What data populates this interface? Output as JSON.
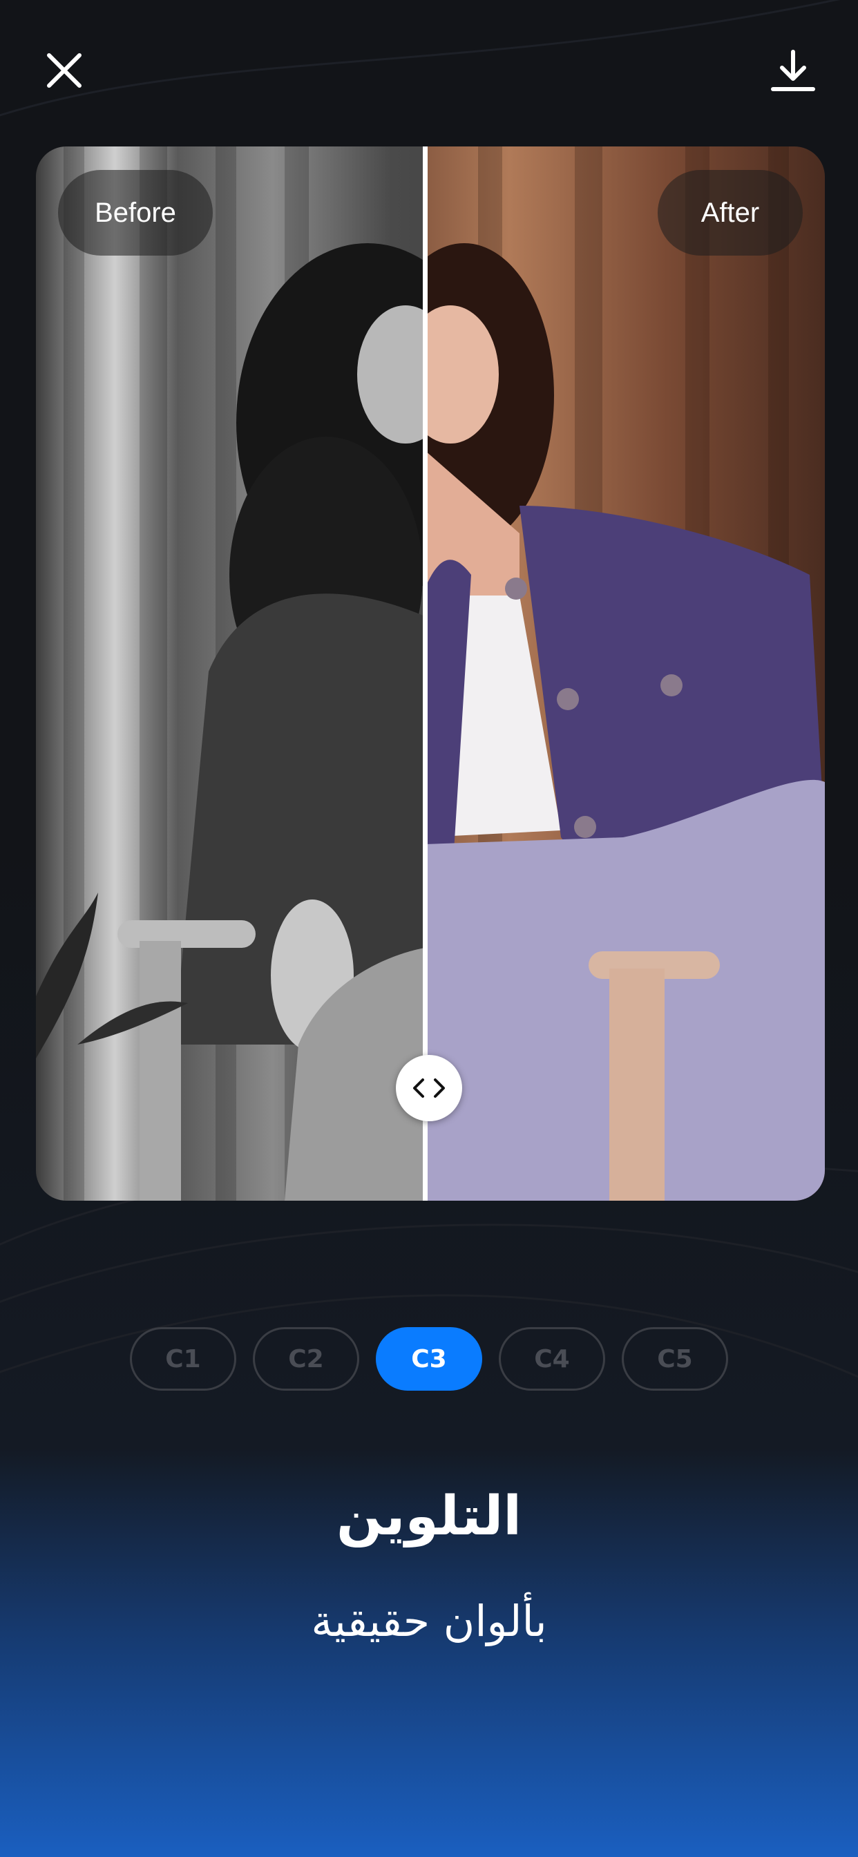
{
  "toolbar": {
    "close_icon": "close-icon",
    "download_icon": "download-icon"
  },
  "compare": {
    "before_label": "Before",
    "after_label": "After",
    "handle_icon": "chevrons-left-right-icon",
    "split_fraction": 0.49
  },
  "chips": [
    {
      "label": "C1",
      "active": false
    },
    {
      "label": "C2",
      "active": false
    },
    {
      "label": "C3",
      "active": true
    },
    {
      "label": "C4",
      "active": false
    },
    {
      "label": "C5",
      "active": false
    }
  ],
  "feature": {
    "title": "التلوين",
    "subtitle": "بألوان حقيقية"
  },
  "colors": {
    "accent": "#0a7cff",
    "background": "#121418",
    "gradient_bottom": "#1a5fc0"
  }
}
